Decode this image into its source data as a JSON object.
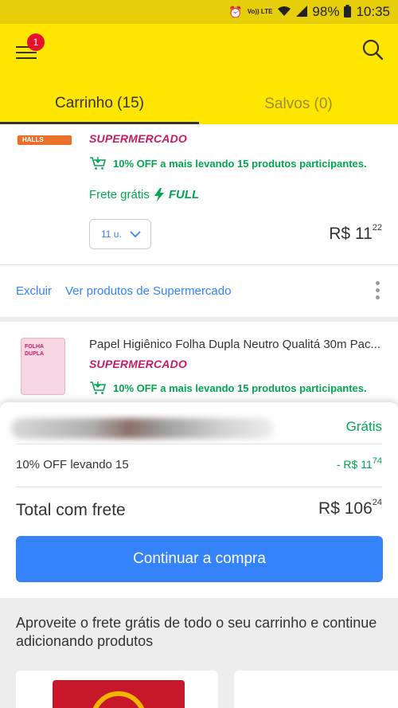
{
  "status_bar": {
    "volte": "Vo)) LTE",
    "battery": "98%",
    "time": "10:35"
  },
  "header": {
    "menu_badge": "1"
  },
  "tabs": [
    {
      "label": "Carrinho (15)",
      "active": true
    },
    {
      "label": "Salvos (0)",
      "active": false
    }
  ],
  "item1": {
    "thumb_text": "HALLS",
    "store": "SUPERMERCADO",
    "promo": "10% OFF a mais levando 15 produtos participantes.",
    "shipping_label": "Frete grátis",
    "shipping_badge": "FULL",
    "quantity": "11 u.",
    "price_int": "R$ 11",
    "price_cents": "22"
  },
  "actions": {
    "delete_label": "Excluir",
    "see_more_label": "Ver produtos de Supermercado"
  },
  "item2": {
    "thumb_text": "FOLHA DUPLA",
    "title": "Papel Higiênico Folha Dupla Neutro Qualitá 30m Pac...",
    "store": "SUPERMERCADO",
    "promo": "10% OFF a mais levando 15 produtos participantes."
  },
  "summary": {
    "shipping_value": "Grátis",
    "discount_label": "10% OFF levando 15",
    "discount_value_int": "- R$ 11",
    "discount_value_cents": "74",
    "total_label": "Total com frete",
    "total_int": "R$ 106",
    "total_cents": "24",
    "cta_label": "Continuar a compra"
  },
  "recommendations": {
    "title": "Aproveite o frete grátis de todo o seu carrinho e continue adicionando produtos"
  },
  "colors": {
    "brand_yellow": "#fee600",
    "accent_blue": "#3483fa",
    "success_green": "#00a650",
    "store_pink": "#c51c64",
    "badge_red": "#e8112d"
  }
}
